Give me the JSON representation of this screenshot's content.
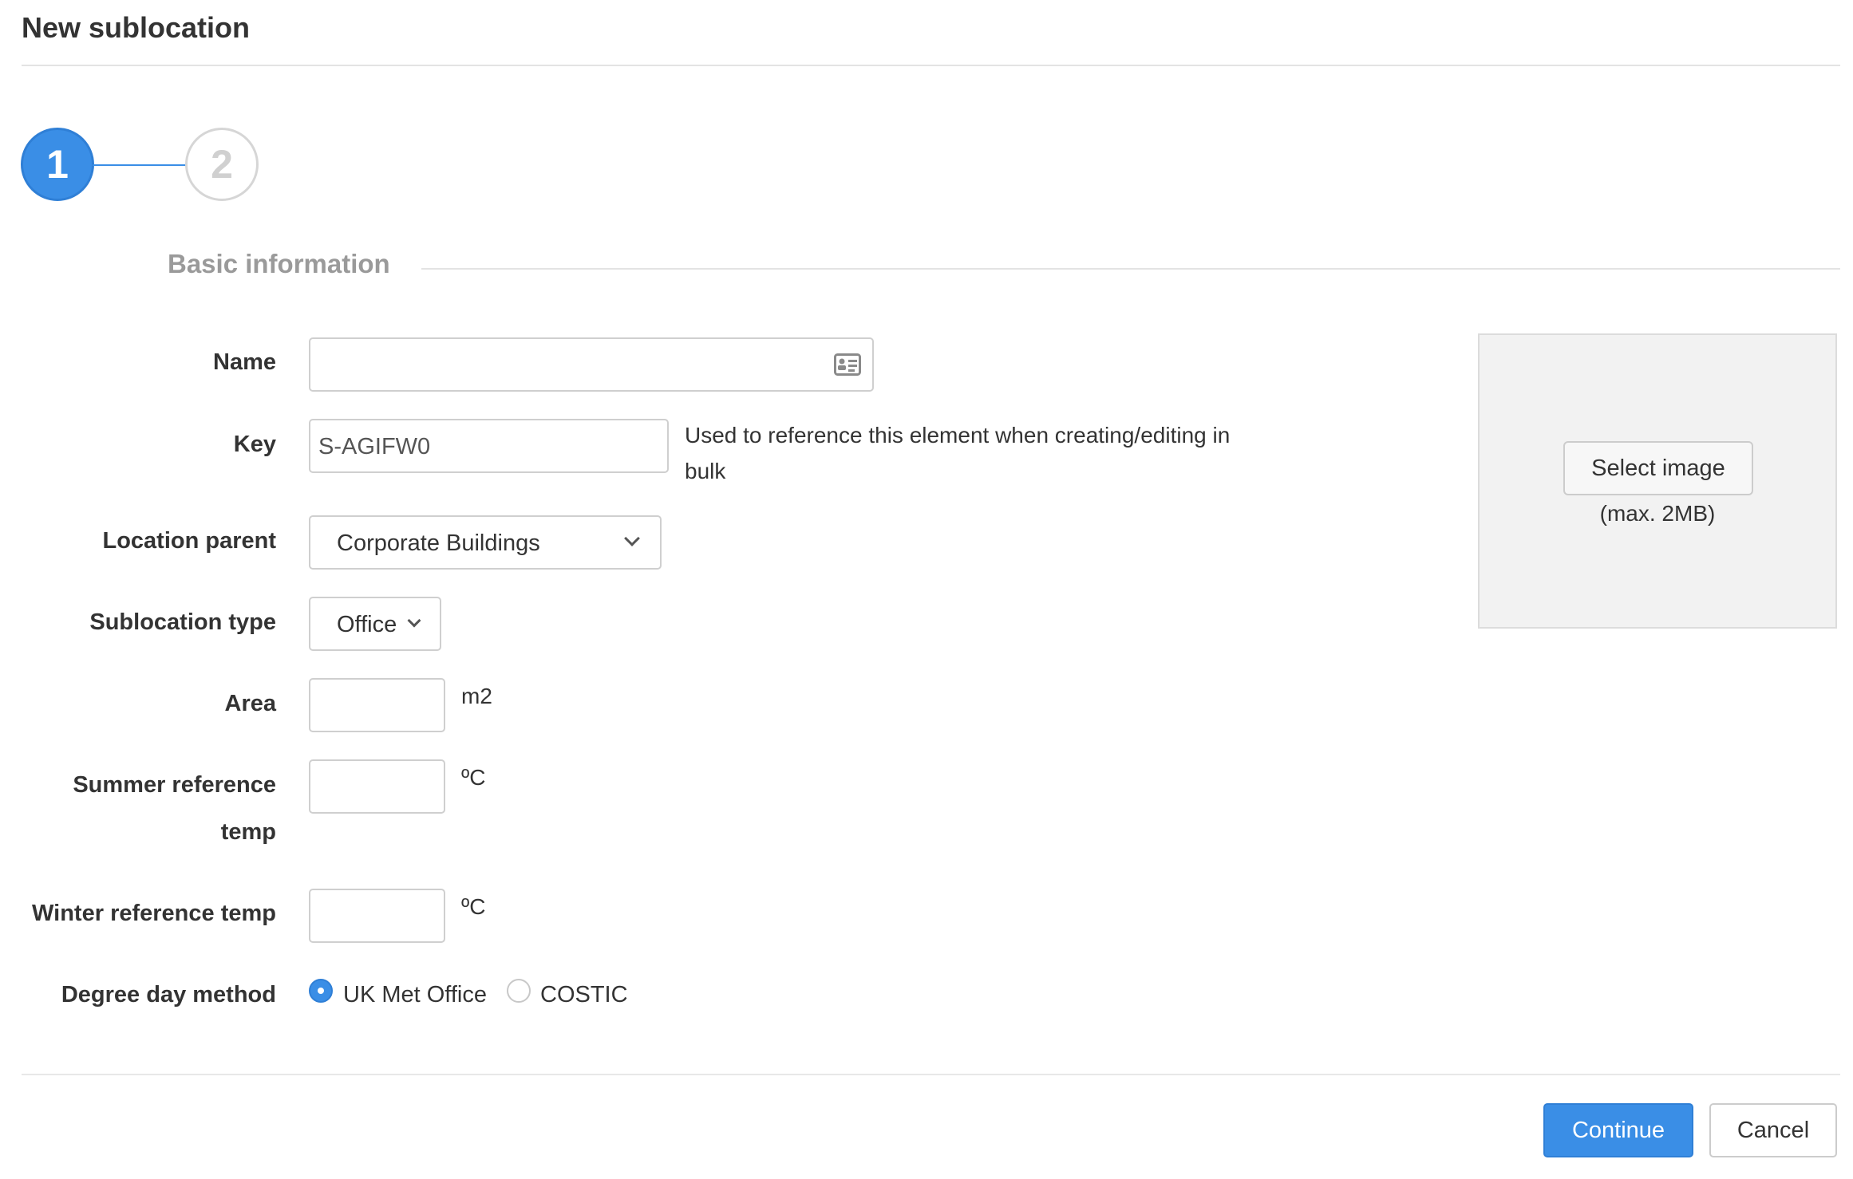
{
  "dialog": {
    "title": "New sublocation"
  },
  "steps": [
    {
      "number": "1",
      "state": "active"
    },
    {
      "number": "2",
      "state": "inactive"
    }
  ],
  "section": {
    "title": "Basic information"
  },
  "form": {
    "name": {
      "label": "Name",
      "value": "",
      "icon": "contact-card-icon"
    },
    "key": {
      "label": "Key",
      "value": "S-AGIFW0",
      "help_line1": "Used to reference this element when creating/editing in",
      "help_line2": "bulk"
    },
    "location_parent": {
      "label": "Location parent",
      "value": "Corporate Buildings",
      "icon": "chevron-down-icon"
    },
    "sublocation_type": {
      "label": "Sublocation type",
      "value": "Office",
      "icon": "chevron-down-icon"
    },
    "area": {
      "label": "Area",
      "value": "",
      "unit": "m2"
    },
    "summer_temp": {
      "label_line1": "Summer reference",
      "label_line2": "temp",
      "value": "",
      "unit": "ºC"
    },
    "winter_temp": {
      "label": "Winter reference temp",
      "value": "",
      "unit": "ºC"
    },
    "degree_day_method": {
      "label": "Degree day method",
      "options": [
        {
          "label": "UK Met Office",
          "selected": true
        },
        {
          "label": "COSTIC",
          "selected": false
        }
      ]
    }
  },
  "image_upload": {
    "button_label": "Select image",
    "note": "(max. 2MB)"
  },
  "footer": {
    "continue_label": "Continue",
    "cancel_label": "Cancel"
  },
  "colors": {
    "accent": "#3a8ee6",
    "panel": "#f2f2f2",
    "border": "#cfcfcf"
  }
}
